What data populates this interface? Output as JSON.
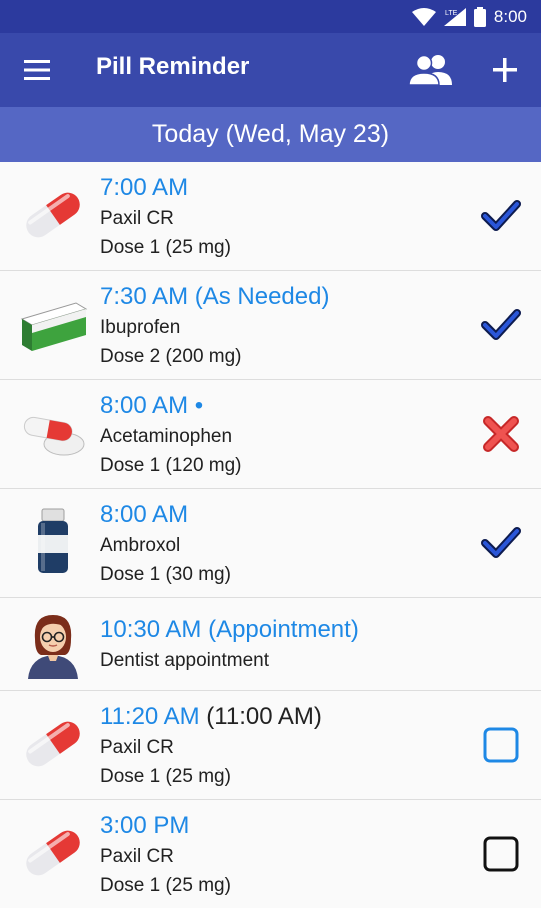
{
  "status_bar": {
    "time": "8:00"
  },
  "app_bar": {
    "title": "Pill Reminder"
  },
  "date_header": {
    "label": "Today (Wed, May 23)"
  },
  "entries": [
    {
      "time": "7:00 AM",
      "name": "Paxil CR",
      "dose": "Dose 1 (25 mg)",
      "image": "capsule-icon",
      "status": "taken"
    },
    {
      "time": "7:30 AM (As Needed)",
      "name": "Ibuprofen",
      "dose": "Dose 2 (200 mg)",
      "image": "pill-box-icon",
      "status": "taken"
    },
    {
      "time": "8:00 AM •",
      "name": "Acetaminophen",
      "dose": "Dose 1 (120 mg)",
      "image": "pills-icon",
      "status": "skipped"
    },
    {
      "time": "8:00 AM",
      "name": "Ambroxol",
      "dose": "Dose 1 (30 mg)",
      "image": "bottle-icon",
      "status": "taken"
    },
    {
      "time": "10:30 AM (Appointment)",
      "name": "Dentist appointment",
      "dose": "",
      "image": "doctor-avatar",
      "status": "none"
    },
    {
      "time": "11:20 AM",
      "scheduled": "(11:00 AM)",
      "name": "Paxil CR",
      "dose": "Dose 1 (25 mg)",
      "image": "capsule-icon",
      "status": "pending"
    },
    {
      "time": "3:00 PM",
      "name": "Paxil CR",
      "dose": "Dose 1 (25 mg)",
      "image": "capsule-icon",
      "status": "upcoming"
    }
  ],
  "colors": {
    "status_bar": "#2c3a9e",
    "app_bar": "#3949ab",
    "date_bar": "#5567c4",
    "time_text": "#1e88e5",
    "check": "#1e40c8",
    "cross": "#e53935"
  }
}
